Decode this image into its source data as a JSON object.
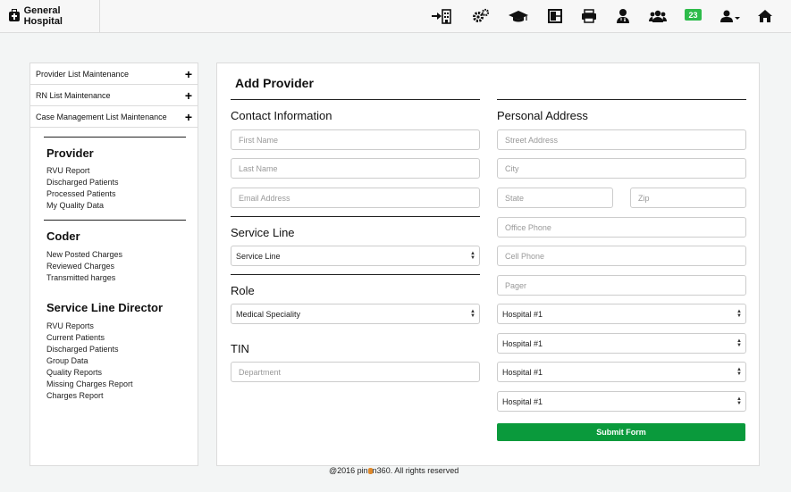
{
  "header": {
    "brand": "General Hospital",
    "notifications_count": "23",
    "icons": [
      "transfer-building-icon",
      "gears-icon",
      "graduation-cap-icon",
      "layout-icon",
      "printer-icon",
      "doctor-icon",
      "group-icon",
      "notification-badge",
      "user-dropdown-icon",
      "home-icon"
    ]
  },
  "sidebar": {
    "accordion": [
      {
        "label": "Provider List Maintenance",
        "icon": "plus"
      },
      {
        "label": "RN List Maintenance",
        "icon": "plus"
      },
      {
        "label": "Case Management List Maintenance",
        "icon": "plus"
      }
    ],
    "sections": [
      {
        "title": "Provider",
        "links": [
          "RVU Report",
          "Discharged Patients",
          "Processed Patients",
          "My Quality Data"
        ]
      },
      {
        "title": "Coder",
        "links": [
          "New Posted Charges",
          "Reviewed Charges",
          "Transmitted harges"
        ]
      },
      {
        "title": "Service Line Director",
        "links": [
          "RVU Reports",
          "Current Patients",
          "Discharged Patients",
          "Group Data",
          "Quality Reports",
          "Missing Charges Report",
          "Charges Report"
        ]
      }
    ]
  },
  "form": {
    "title": "Add Provider",
    "contact": {
      "heading": "Contact Information",
      "first_name": "First Name",
      "last_name": "Last Name",
      "email": "Email Address"
    },
    "service_line": {
      "heading": "Service Line",
      "selected": "Service Line"
    },
    "role": {
      "heading": "Role",
      "selected": "Medical Speciality"
    },
    "tin": {
      "heading": "TIN",
      "department": "Department"
    },
    "address": {
      "heading": "Personal Address",
      "street": "Street Address",
      "city": "City",
      "state": "State",
      "zip": "Zip",
      "office_phone": "Office Phone",
      "cell_phone": "Cell Phone",
      "pager": "Pager",
      "hospitals": [
        "Hospital #1",
        "Hospital #1",
        "Hospital #1",
        "Hospital #1"
      ]
    },
    "submit": "Submit Form"
  },
  "footer": {
    "prefix": "@2016 pin",
    "suffix": "n360. All rights reserved"
  },
  "colors": {
    "submit": "#0a9a3c",
    "badge": "#2dbb4a"
  }
}
